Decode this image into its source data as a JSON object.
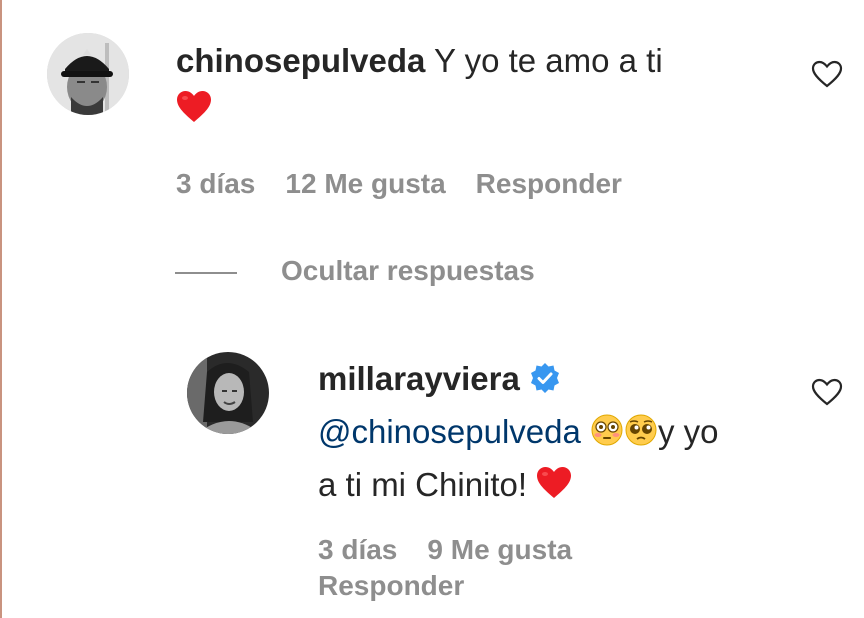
{
  "comment": {
    "username": "chinosepulveda",
    "text": "Y yo te amo a ti",
    "emoji": "red-heart",
    "time": "3 días",
    "likes": "12 Me gusta",
    "reply_label": "Responder",
    "like_icon": "heart-outline-icon"
  },
  "replies_toggle": {
    "label": "Ocultar respuestas"
  },
  "reply": {
    "username": "millarayviera",
    "verified": true,
    "mention": "@chinosepulveda",
    "text_1": "y yo",
    "text_2": "a ti mi Chinito!",
    "emojis": [
      "flushed-face",
      "pleading-face",
      "red-heart"
    ],
    "time": "3 días",
    "likes": "9 Me gusta",
    "reply_label": "Responder",
    "like_icon": "heart-outline-icon"
  },
  "colors": {
    "text": "#262626",
    "muted": "#8e8e8e",
    "mention": "#00376b",
    "verified": "#3897f0",
    "heart": "#ed1c24"
  }
}
